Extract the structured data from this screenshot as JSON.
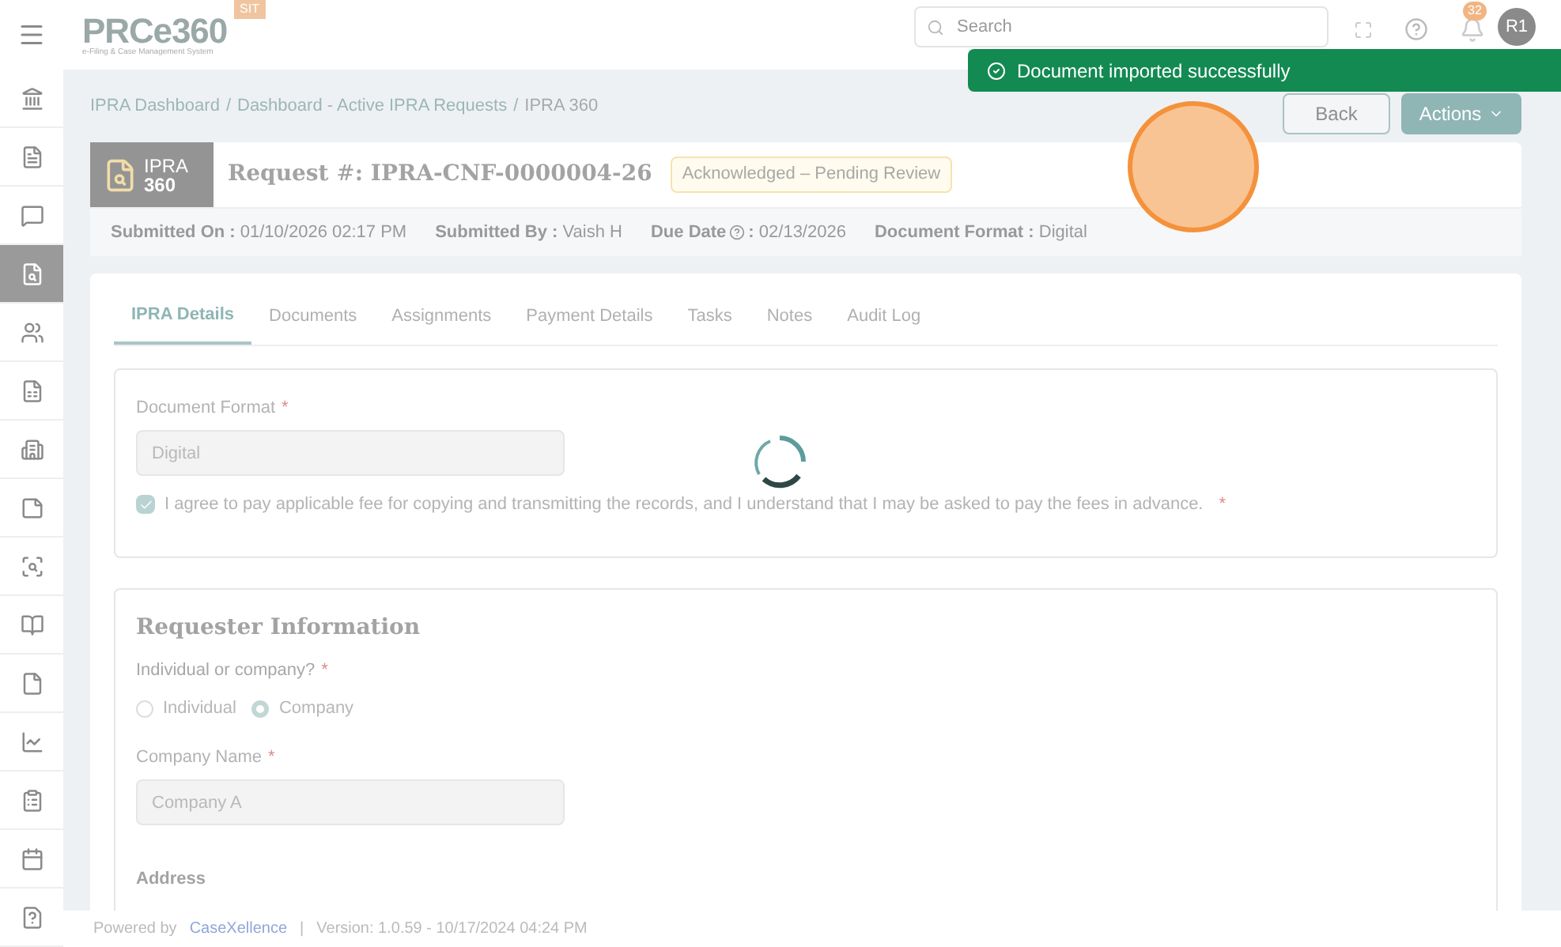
{
  "header": {
    "logo": "PRCe360",
    "logo_tagline": "e-Filing & Case Management System",
    "env_badge": "SIT",
    "search": {
      "placeholder": "Search"
    },
    "notification_count": "32",
    "avatar": "R1"
  },
  "toast": {
    "message": "Document imported successfully"
  },
  "sidebar": {
    "items": [
      {
        "kind": "landmark",
        "selected": false
      },
      {
        "kind": "file",
        "selected": false
      },
      {
        "kind": "message",
        "selected": false
      },
      {
        "kind": "file-search",
        "selected": true
      },
      {
        "kind": "users",
        "selected": false
      },
      {
        "kind": "file-dollar",
        "selected": false
      },
      {
        "kind": "building",
        "selected": false
      },
      {
        "kind": "note",
        "selected": false
      },
      {
        "kind": "scan",
        "selected": false
      },
      {
        "kind": "book",
        "selected": false
      },
      {
        "kind": "file-text",
        "selected": false
      },
      {
        "kind": "chart",
        "selected": false
      },
      {
        "kind": "clipboard",
        "selected": false
      },
      {
        "kind": "calendar",
        "selected": false
      },
      {
        "kind": "help",
        "selected": false
      }
    ]
  },
  "breadcrumb": {
    "separator": "/",
    "items": [
      "IPRA Dashboard",
      "Dashboard - Active IPRA Requests",
      "IPRA 360"
    ]
  },
  "buttons": {
    "back": "Back",
    "actions": "Actions"
  },
  "request": {
    "badge_line1": "IPRA",
    "badge_line2": "360",
    "title_label": "Request",
    "title_mark": "#",
    "title_id": ": IPRA-CNF-0000004-26",
    "status": "Acknowledged – Pending Review",
    "meta": [
      {
        "label": "Submitted On :",
        "value": "01/10/2026 02:17 PM"
      },
      {
        "label": "Submitted By :",
        "value": "Vaish H"
      },
      {
        "label": "Due Date",
        "kind": "help",
        "colon": ":",
        "value": "02/13/2026"
      },
      {
        "label": "Document Format :",
        "value": "Digital"
      }
    ]
  },
  "tabs": [
    {
      "label": "IPRA Details",
      "selected": true
    },
    {
      "label": "Documents",
      "selected": false
    },
    {
      "label": "Assignments",
      "selected": false
    },
    {
      "label": "Payment Details",
      "selected": false
    },
    {
      "label": "Tasks",
      "selected": false
    },
    {
      "label": "Notes",
      "selected": false
    },
    {
      "label": "Audit Log",
      "selected": false
    }
  ],
  "format_section": {
    "label": "Document Format",
    "required_mark": "*",
    "value": "Digital",
    "agree": {
      "text": "I agree to pay applicable fee for copying and transmitting the records, and I understand that I may be asked to pay the fees in advance.",
      "checked": true,
      "required_mark": "*"
    }
  },
  "requester": {
    "title": "Requester Information",
    "type_label": "Individual or company?",
    "type_required_mark": "*",
    "options": [
      {
        "label": "Individual",
        "selected": false
      },
      {
        "label": "Company",
        "selected": true
      }
    ],
    "company_label": "Company Name",
    "company_required_mark": "*",
    "company_value": "Company A",
    "address_label": "Address"
  },
  "footer": {
    "powered_by": "Powered by",
    "brand": "CaseXellence",
    "separator": "|",
    "version": "Version: 1.0.59 - 10/17/2024 04:24 PM"
  }
}
